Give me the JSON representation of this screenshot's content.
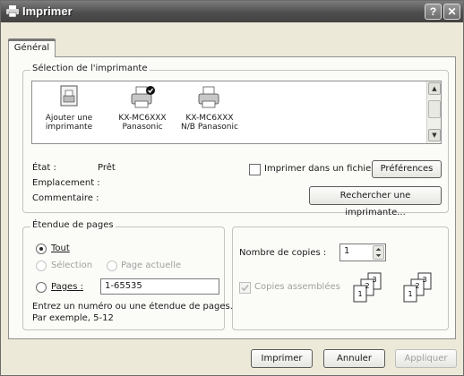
{
  "window": {
    "title": "Imprimer",
    "help_label": "?",
    "close_label": "✕"
  },
  "tabs": [
    {
      "label": "Général"
    }
  ],
  "printer_selection": {
    "legend": "Sélection de l'imprimante",
    "printers": [
      {
        "label_line1": "Ajouter une",
        "label_line2": "imprimante",
        "icon": "add-printer-icon"
      },
      {
        "label_line1": "KX-MC6XXX",
        "label_line2": "Panasonic",
        "icon": "printer-icon",
        "default": true
      },
      {
        "label_line1": "KX-MC6XXX",
        "label_line2": "N/B Panasonic",
        "icon": "printer-icon"
      }
    ],
    "status_label": "État :",
    "status_value": "Prêt",
    "location_label": "Emplacement :",
    "comment_label": "Commentaire :",
    "print_to_file_label": "Imprimer dans un fichier",
    "preferences_label": "Préférences",
    "find_printer_label": "Rechercher une imprimante..."
  },
  "page_range": {
    "legend": "Étendue de pages",
    "all_label": "Tout",
    "selection_label": "Sélection",
    "current_page_label": "Page actuelle",
    "pages_label": "Pages :",
    "pages_value": "1-65535",
    "hint_line1": "Entrez un numéro ou une étendue de pages.",
    "hint_line2": "Par exemple, 5-12"
  },
  "copies": {
    "count_label": "Nombre de copies :",
    "count_value": "1",
    "collate_label": "Copies assemblées",
    "collate_page_labels": [
      "1",
      "2",
      "3"
    ]
  },
  "footer": {
    "print_label": "Imprimer",
    "cancel_label": "Annuler",
    "apply_label": "Appliquer"
  }
}
